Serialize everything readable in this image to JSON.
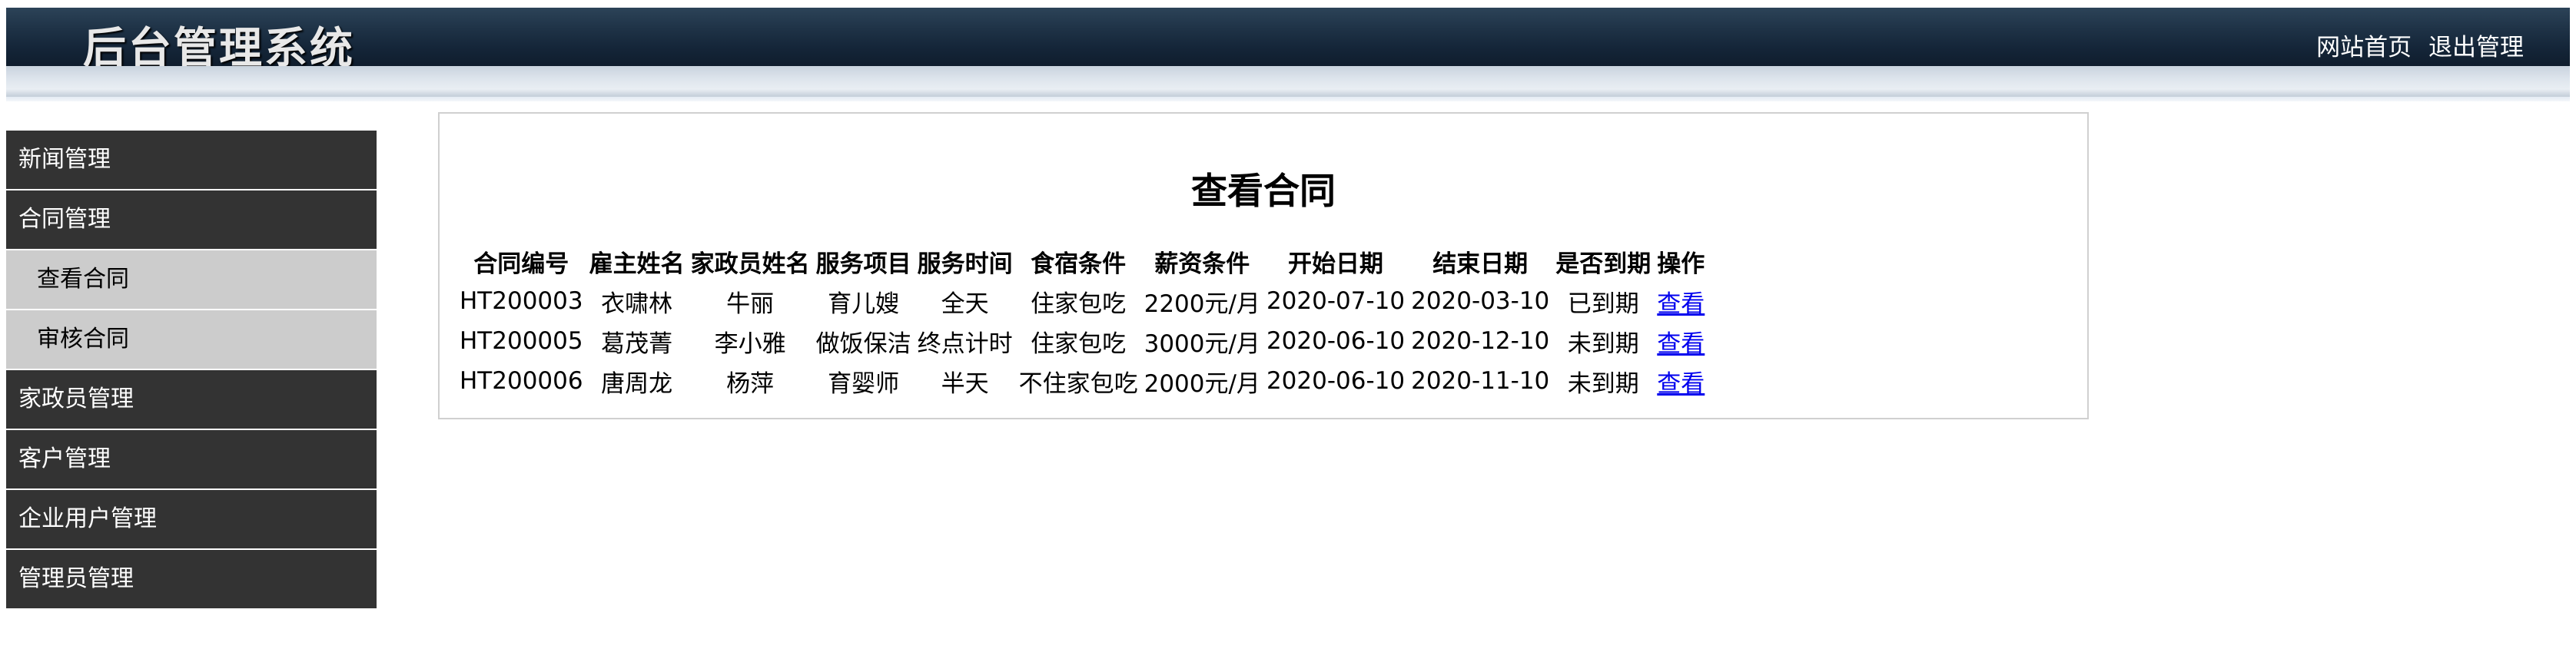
{
  "header": {
    "logo_text": "后台管理系统",
    "links": [
      {
        "label": "网站首页"
      },
      {
        "label": "退出管理"
      }
    ]
  },
  "sidebar": {
    "items": [
      {
        "label": "新闻管理",
        "type": "section"
      },
      {
        "label": "合同管理",
        "type": "section"
      },
      {
        "label": "查看合同",
        "type": "sub"
      },
      {
        "label": "审核合同",
        "type": "sub"
      },
      {
        "label": "家政员管理",
        "type": "section"
      },
      {
        "label": "客户管理",
        "type": "section"
      },
      {
        "label": "企业用户管理",
        "type": "section"
      },
      {
        "label": "管理员管理",
        "type": "section"
      }
    ]
  },
  "main": {
    "title": "查看合同",
    "table": {
      "columns": [
        "合同编号",
        "雇主姓名",
        "家政员姓名",
        "服务项目",
        "服务时间",
        "食宿条件",
        "薪资条件",
        "开始日期",
        "结束日期",
        "是否到期",
        "操作"
      ],
      "rows": [
        [
          "HT200003",
          "衣啸林",
          "牛丽",
          "育儿嫂",
          "全天",
          "住家包吃",
          "2200元/月",
          "2020-07-10",
          "2020-03-10",
          "已到期",
          "查看"
        ],
        [
          "HT200005",
          "葛茂菁",
          "李小雅",
          "做饭保洁",
          "终点计时",
          "住家包吃",
          "3000元/月",
          "2020-06-10",
          "2020-12-10",
          "未到期",
          "查看"
        ],
        [
          "HT200006",
          "唐周龙",
          "杨萍",
          "育婴师",
          "半天",
          "不住家包吃",
          "2000元/月",
          "2020-06-10",
          "2020-11-10",
          "未到期",
          "查看"
        ]
      ]
    }
  },
  "colors": {
    "header_bg": "#1f3347",
    "sidebar_section_bg": "#333333",
    "sidebar_sub_bg": "#cccccc",
    "link": "#0000ee"
  }
}
